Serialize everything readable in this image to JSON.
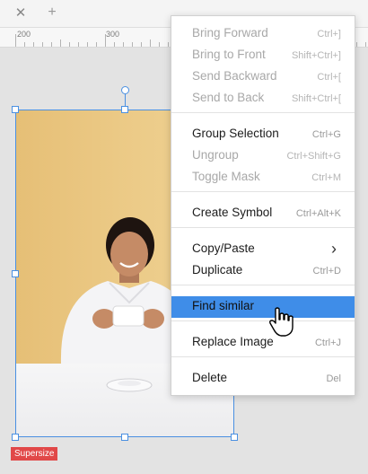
{
  "tabbar": {
    "close_icon": "close-icon",
    "add_icon": "plus-icon"
  },
  "ruler": {
    "labels": [
      "200",
      "300"
    ]
  },
  "selection": {
    "badge": "Supersize"
  },
  "menu": {
    "groups": [
      [
        {
          "label": "Bring Forward",
          "shortcut": "Ctrl+]",
          "enabled": false
        },
        {
          "label": "Bring to Front",
          "shortcut": "Shift+Ctrl+]",
          "enabled": false
        },
        {
          "label": "Send Backward",
          "shortcut": "Ctrl+[",
          "enabled": false
        },
        {
          "label": "Send to Back",
          "shortcut": "Shift+Ctrl+[",
          "enabled": false
        }
      ],
      [
        {
          "label": "Group Selection",
          "shortcut": "Ctrl+G",
          "enabled": true
        },
        {
          "label": "Ungroup",
          "shortcut": "Ctrl+Shift+G",
          "enabled": false
        },
        {
          "label": "Toggle Mask",
          "shortcut": "Ctrl+M",
          "enabled": false
        }
      ],
      [
        {
          "label": "Create Symbol",
          "shortcut": "Ctrl+Alt+K",
          "enabled": true
        }
      ],
      [
        {
          "label": "Copy/Paste",
          "shortcut": "",
          "enabled": true,
          "submenu": true
        },
        {
          "label": "Duplicate",
          "shortcut": "Ctrl+D",
          "enabled": true
        }
      ],
      [
        {
          "label": "Find similar",
          "shortcut": "",
          "enabled": true,
          "active": true
        }
      ],
      [
        {
          "label": "Replace Image",
          "shortcut": "Ctrl+J",
          "enabled": true
        }
      ],
      [
        {
          "label": "Delete",
          "shortcut": "Del",
          "enabled": true
        }
      ]
    ]
  },
  "colors": {
    "accent": "#3f8de8",
    "selection": "#4a90e2",
    "badge": "#e14848"
  }
}
